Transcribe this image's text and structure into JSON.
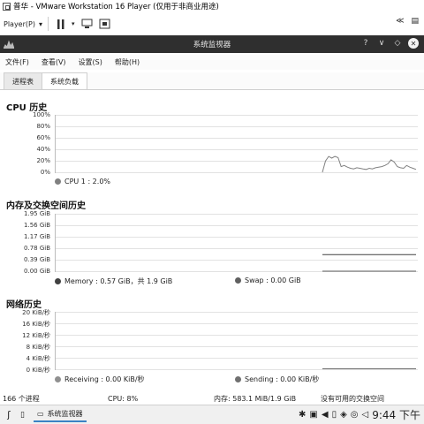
{
  "vmware": {
    "title": "普华 - VMware Workstation 16 Player (仅用于非商业用途)",
    "player_label": "Player(P)",
    "icons": [
      "pause-icon",
      "send-ctrl-alt-del-icon",
      "fit-guest-icon",
      "unity-icon",
      "collapse-icon",
      "library-icon"
    ]
  },
  "window": {
    "title": "系统监视器",
    "controls": [
      "?",
      "∨",
      "◇",
      "✕"
    ]
  },
  "menu": {
    "items": [
      "文件(F)",
      "查看(V)",
      "设置(S)",
      "帮助(H)"
    ]
  },
  "tabs": [
    {
      "label": "进程表",
      "active": false
    },
    {
      "label": "系统负载",
      "active": true
    }
  ],
  "cpu": {
    "title": "CPU 历史",
    "ticks": [
      "100%",
      "80%",
      "60%",
      "40%",
      "20%",
      "0%"
    ],
    "legend": "CPU 1 : 2.0%",
    "legend_color": "#808080"
  },
  "memory": {
    "title": "内存及交换空间历史",
    "ticks": [
      "1.95 GiB",
      "1.56 GiB",
      "1.17 GiB",
      "0.78 GiB",
      "0.39 GiB",
      "0.00 GiB"
    ],
    "legend_memory": "Memory : 0.57 GiB，共 1.9 GiB",
    "legend_swap": "Swap : 0.00 GiB",
    "memory_color": "#404040",
    "swap_color": "#606060"
  },
  "network": {
    "title": "网络历史",
    "ticks": [
      "20 KiB/秒",
      "16 KiB/秒",
      "12 KiB/秒",
      "8 KiB/秒",
      "4 KiB/秒",
      "0 KiB/秒"
    ],
    "legend_receiving": "Receiving : 0.00 KiB/秒",
    "legend_sending": "Sending : 0.00 KiB/秒",
    "receiving_color": "#909090",
    "sending_color": "#707070"
  },
  "status": {
    "processes": "166 个进程",
    "cpu": "CPU: 8%",
    "memory": "内存: 583.1 MiB/1.9 GiB",
    "swap": "没有可用的交换空间"
  },
  "taskbar": {
    "app_label": "系统监视器",
    "clock": "9:44 下午"
  },
  "chart_data": [
    {
      "type": "line",
      "title": "CPU 历史",
      "series": [
        {
          "name": "CPU 1",
          "values": [
            0,
            0,
            0,
            0,
            0,
            0,
            0,
            0,
            0,
            0,
            0,
            0,
            0,
            0,
            0,
            0,
            0,
            0,
            0,
            0,
            0,
            0,
            0,
            0,
            0,
            0,
            0,
            0,
            0,
            0,
            0,
            0,
            0,
            0,
            0,
            0,
            0,
            0,
            0,
            0,
            0,
            0,
            0,
            0,
            0,
            0,
            0,
            0,
            0,
            0,
            0,
            0,
            0,
            0,
            0,
            0,
            0,
            0,
            0,
            0,
            0,
            0,
            0,
            0,
            0,
            0,
            0,
            0,
            0,
            0,
            0,
            0,
            0,
            0,
            0,
            0,
            0,
            0,
            0,
            0,
            0,
            0,
            0,
            0,
            0,
            0,
            0,
            0,
            0,
            0,
            0,
            0,
            0,
            0,
            0,
            0,
            0,
            0,
            0,
            0,
            0,
            0,
            0,
            0,
            0,
            0,
            0,
            0,
            0,
            0,
            0,
            0,
            0,
            0,
            0,
            0,
            0,
            0,
            0,
            0,
            0,
            0,
            0,
            0,
            0,
            0,
            0,
            0,
            0,
            0,
            0,
            0,
            0,
            0,
            0,
            0,
            0,
            0,
            0,
            0,
            0,
            0,
            0,
            0,
            0,
            0,
            0,
            0,
            0,
            0,
            0,
            0,
            0,
            0,
            0,
            0,
            0,
            0,
            0,
            0,
            0,
            0,
            0,
            0,
            0,
            0,
            0,
            0,
            0,
            0,
            0,
            0,
            0,
            0,
            0,
            0,
            0,
            0,
            0,
            0,
            0,
            0,
            0,
            0,
            0,
            0,
            0,
            0,
            0,
            0,
            0,
            0,
            0,
            0,
            0,
            0,
            0,
            0,
            0,
            0,
            0,
            0,
            0,
            0,
            0,
            0,
            0,
            0,
            0,
            0,
            0,
            0,
            0,
            0,
            0,
            0,
            0,
            0,
            0,
            0,
            0,
            0,
            0,
            0,
            0,
            0,
            0,
            0,
            0,
            0,
            0,
            0,
            0,
            0,
            0,
            0,
            0,
            0,
            0,
            0,
            0,
            0,
            0,
            0,
            0,
            0,
            0,
            0,
            0,
            0,
            0,
            0,
            0,
            0,
            0,
            0,
            0,
            0,
            0,
            0,
            0,
            0,
            0,
            0,
            0,
            0,
            0,
            0,
            0,
            0,
            0,
            0,
            0,
            0,
            0,
            0,
            0,
            0,
            0,
            0,
            0,
            0,
            0,
            0,
            0,
            0,
            0,
            0,
            0,
            0,
            0,
            0,
            0,
            0,
            0,
            0,
            0,
            0,
            0,
            0,
            0,
            0,
            0,
            0,
            0,
            0,
            0,
            0,
            0,
            0,
            0,
            0,
            0,
            0,
            0,
            0,
            0,
            0,
            0,
            0,
            0,
            0,
            0,
            0,
            0,
            0,
            0,
            0,
            0,
            0,
            0,
            0,
            0,
            0,
            0,
            0,
            0,
            0,
            0,
            0,
            0,
            0,
            0,
            0,
            0,
            0,
            0,
            0,
            0,
            0,
            0,
            0,
            0,
            0,
            0,
            0,
            0,
            0,
            0,
            0,
            0,
            0,
            0,
            0,
            0,
            0,
            0,
            0,
            0,
            0,
            0,
            0,
            0,
            0,
            0,
            0,
            0,
            0,
            0,
            0,
            0,
            0,
            0,
            0,
            0,
            0,
            0,
            0,
            0,
            0,
            0,
            0,
            0,
            0,
            0,
            0,
            0,
            0,
            0,
            0,
            0,
            0,
            0,
            0,
            0,
            0,
            0,
            0,
            0,
            0
          ]
        }
      ],
      "recent": [
        0,
        20,
        28,
        25,
        28,
        26,
        10,
        12,
        9,
        7,
        6,
        8,
        7,
        6,
        5,
        7,
        6,
        8,
        9,
        10,
        12,
        15,
        22,
        18,
        10,
        8,
        7,
        12,
        9,
        7,
        5
      ],
      "ylim": [
        0,
        100
      ]
    },
    {
      "type": "line",
      "title": "内存及交换空间历史",
      "series": [
        {
          "name": "Memory",
          "recent_value": 0.57
        },
        {
          "name": "Swap",
          "recent_value": 0.0
        }
      ],
      "ylim": [
        0,
        1.95
      ]
    },
    {
      "type": "line",
      "title": "网络历史",
      "series": [
        {
          "name": "Receiving",
          "recent_value": 0.0
        },
        {
          "name": "Sending",
          "recent_value": 0.0
        }
      ],
      "ylim": [
        0,
        20
      ]
    }
  ]
}
